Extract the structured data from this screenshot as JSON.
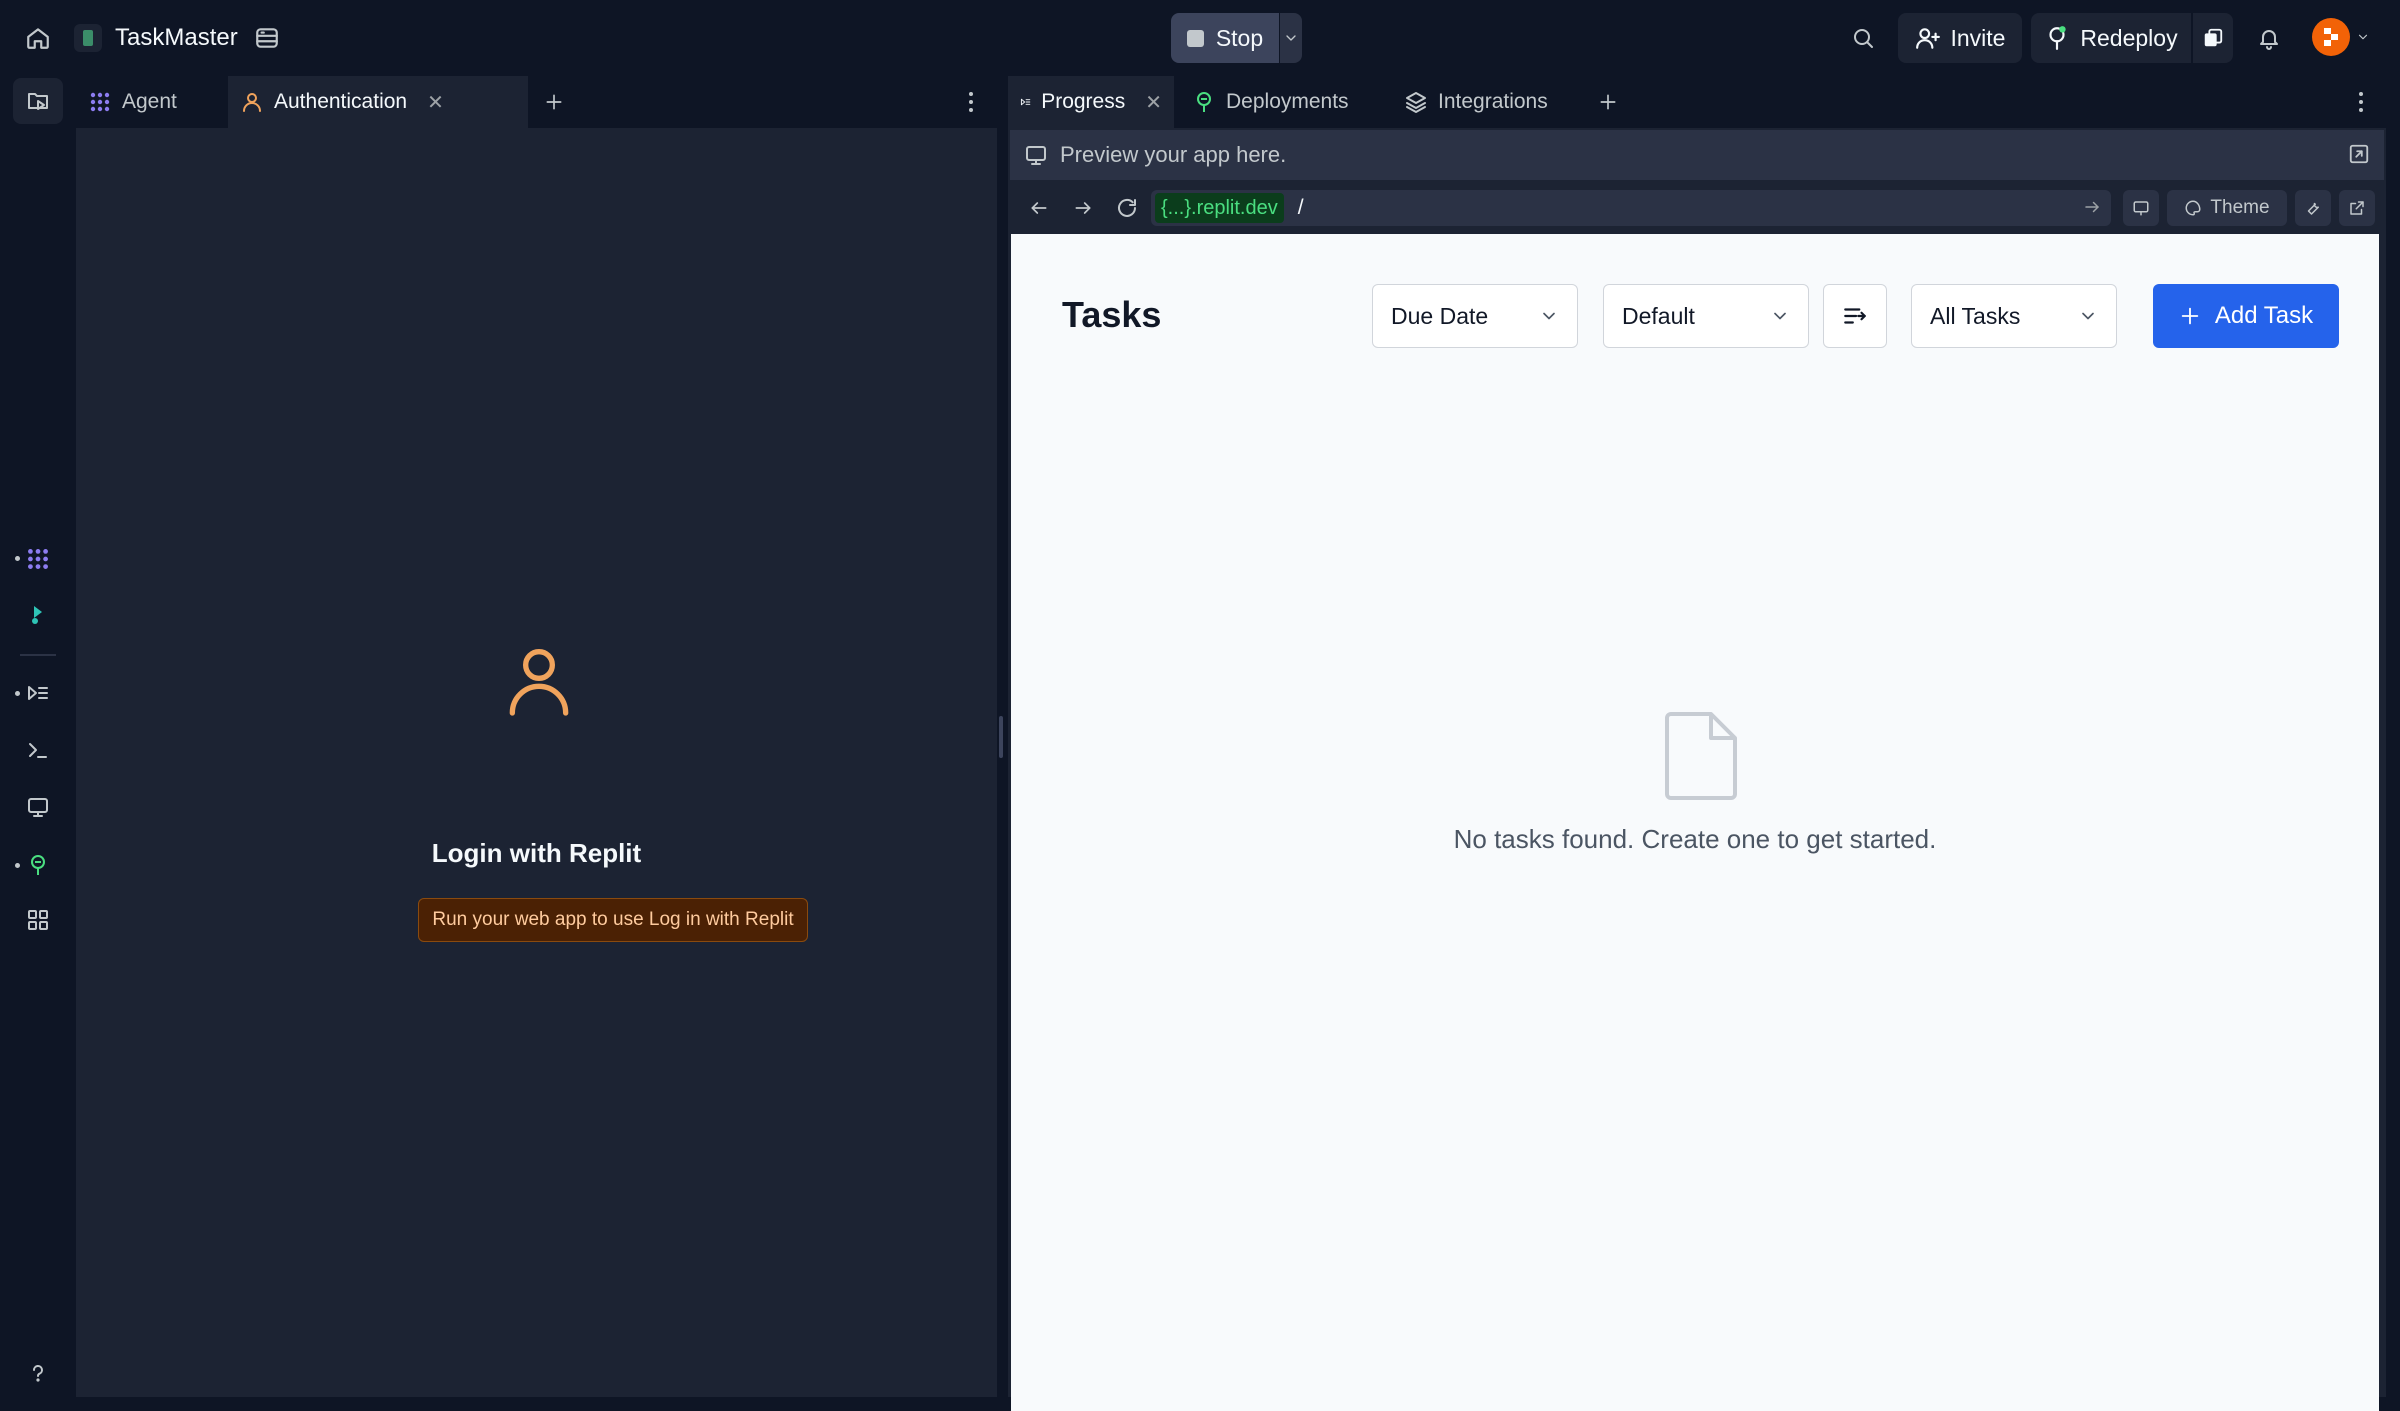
{
  "topbar": {
    "project_name": "TaskMaster",
    "stop_label": "Stop",
    "invite_label": "Invite",
    "redeploy_label": "Redeploy"
  },
  "left_pane": {
    "tabs": [
      {
        "label": "Agent",
        "icon": "agent-icon"
      },
      {
        "label": "Authentication",
        "icon": "user-icon",
        "active": true
      }
    ],
    "auth": {
      "title": "Login with Replit",
      "note": "Run your web app to use Log in with Replit"
    }
  },
  "right_pane": {
    "tabs": [
      {
        "label": "Progress",
        "icon": "progress-icon",
        "active": true
      },
      {
        "label": "Deployments",
        "icon": "deploy-icon"
      },
      {
        "label": "Integrations",
        "icon": "layers-icon"
      }
    ],
    "preview_hint": "Preview your app here.",
    "url_host": "{...}.replit.dev",
    "url_path": "/",
    "theme_label": "Theme"
  },
  "app": {
    "title": "Tasks",
    "sort_field": "Due Date",
    "sort_order": "Default",
    "filter": "All Tasks",
    "add_label": "Add Task",
    "empty_message": "No tasks found. Create one to get started.",
    "accent": "#2563eb"
  },
  "colors": {
    "background": "#0e1525",
    "panel": "#1c2333",
    "auth_accent": "#f0a35c"
  }
}
